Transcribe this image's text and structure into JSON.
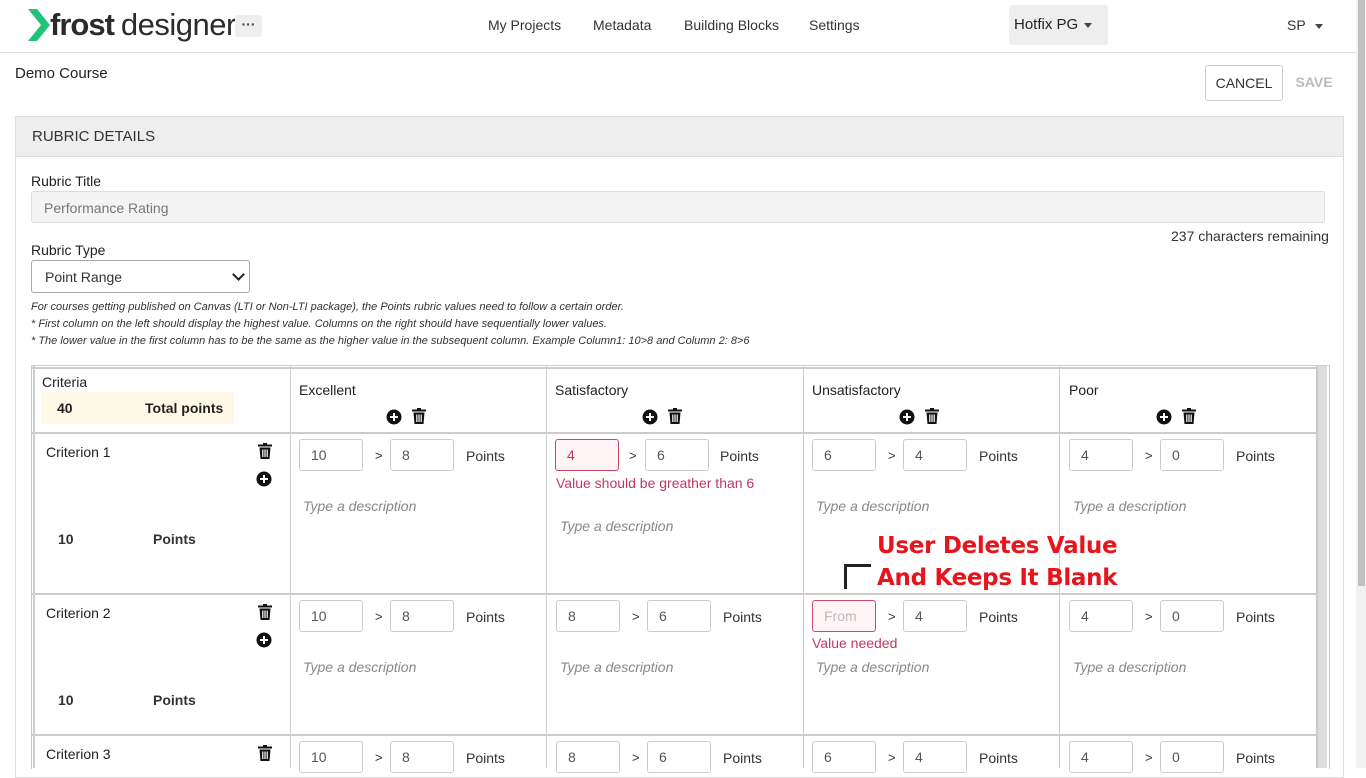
{
  "nav": {
    "brand_bold": "frost",
    "brand_light": "designer",
    "more": "···",
    "links": [
      "My Projects",
      "Metadata",
      "Building Blocks",
      "Settings"
    ],
    "workspace": "Hotfix PG",
    "user": "SP"
  },
  "header": {
    "course": "Demo Course",
    "cancel": "CANCEL",
    "save": "SAVE"
  },
  "panel": {
    "title": "RUBRIC DETAILS",
    "rubric_title_label": "Rubric Title",
    "rubric_title_value": "Performance Rating",
    "chars_remaining": "237 characters remaining",
    "rubric_type_label": "Rubric Type",
    "rubric_type_value": "Point Range",
    "notes": [
      "For courses getting published on Canvas (LTI or Non-LTI package), the Points rubric values need to follow a certain order.",
      "* First column on the left should display the highest value. Columns on the right should have sequentially lower values.",
      "* The lower value in the first column has to be the same as the higher value in the subsequent column. Example Column1: 10>8 and Column 2: 8>6"
    ]
  },
  "table": {
    "criteria_header": "Criteria",
    "total_value": "40",
    "total_label": "Total points",
    "columns": [
      "Excellent",
      "Satisfactory",
      "Unsatisfactory",
      "Poor"
    ],
    "gt": ">",
    "points_label": "Points",
    "desc_placeholder": "Type a description",
    "rows": [
      {
        "name": "Criterion 1",
        "points": "10",
        "points_label": "Points",
        "cells": [
          [
            "10",
            "8"
          ],
          [
            "4",
            "6"
          ],
          [
            "6",
            "4"
          ],
          [
            "4",
            "0"
          ]
        ]
      },
      {
        "name": "Criterion 2",
        "points": "10",
        "points_label": "Points",
        "cells": [
          [
            "10",
            "8"
          ],
          [
            "8",
            "6"
          ],
          [
            "From",
            "4"
          ],
          [
            "4",
            "0"
          ]
        ]
      },
      {
        "name": "Criterion 3",
        "cells": [
          [
            "10",
            "8"
          ],
          [
            "8",
            "6"
          ],
          [
            "6",
            "4"
          ],
          [
            "4",
            "0"
          ]
        ]
      }
    ],
    "errors": {
      "r1_satisfactory": "Value should be greather than 6",
      "r2_unsatisfactory": "Value needed"
    }
  },
  "annotation": {
    "line1": "User Deletes Value",
    "line2": "And Keeps It Blank"
  },
  "colors": {
    "brand_green": "#1fc47a",
    "error": "#c0385d",
    "annotation": "#e8141c"
  },
  "icons": [
    "chevron-logo-icon",
    "plus-circle-icon",
    "trash-icon",
    "caret-down-icon"
  ]
}
